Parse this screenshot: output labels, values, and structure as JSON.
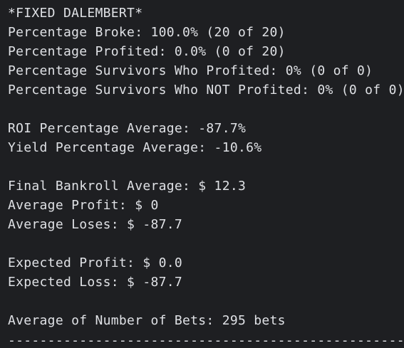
{
  "terminal": {
    "colors": {
      "background": "#1e1f22",
      "text": "#dfe1e5"
    },
    "title": "*FIXED DALEMBERT*",
    "percentage_broke": "Percentage Broke: 100.0% (20 of 20)",
    "percentage_profited": "Percentage Profited: 0.0% (0 of 20)",
    "survivors_profited": "Percentage Survivors Who Profited: 0% (0 of 0)",
    "survivors_not_profited": "Percentage Survivors Who NOT Profited: 0% (0 of 0)",
    "roi_average": "ROI Percentage Average: -87.7%",
    "yield_average": "Yield Percentage Average: -10.6%",
    "final_bankroll_average": "Final Bankroll Average: $ 12.3",
    "average_profit": "Average Profit: $ 0",
    "average_loses": "Average Loses: $ -87.7",
    "expected_profit": "Expected Profit: $ 0.0",
    "expected_loss": "Expected Loss: $ -87.7",
    "average_number_of_bets": "Average of Number of Bets: 295 bets",
    "separator": "----------------------------------------------------------------"
  }
}
